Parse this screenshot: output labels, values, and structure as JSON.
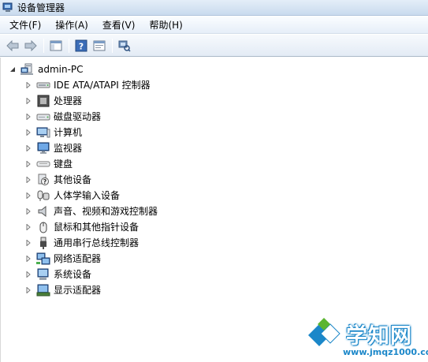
{
  "window": {
    "title": "设备管理器"
  },
  "menu": [
    {
      "label": "文件(F)"
    },
    {
      "label": "操作(A)"
    },
    {
      "label": "查看(V)"
    },
    {
      "label": "帮助(H)"
    }
  ],
  "toolbar": {
    "buttons": [
      {
        "icon": "back-arrow-icon"
      },
      {
        "icon": "forward-arrow-icon"
      },
      {
        "icon": "show-hide-console-tree-icon"
      },
      {
        "icon": "help-icon"
      },
      {
        "icon": "properties-icon"
      },
      {
        "icon": "scan-hardware-icon"
      }
    ]
  },
  "tree": {
    "root": {
      "label": "admin-PC",
      "icon": "computer-icon",
      "expanded": true
    },
    "items": [
      {
        "label": "IDE ATA/ATAPI 控制器",
        "icon": "ide-controller-icon"
      },
      {
        "label": "处理器",
        "icon": "processor-icon"
      },
      {
        "label": "磁盘驱动器",
        "icon": "disk-drive-icon"
      },
      {
        "label": "计算机",
        "icon": "computer-icon"
      },
      {
        "label": "监视器",
        "icon": "monitor-icon"
      },
      {
        "label": "键盘",
        "icon": "keyboard-icon"
      },
      {
        "label": "其他设备",
        "icon": "other-devices-icon"
      },
      {
        "label": "人体学输入设备",
        "icon": "hid-icon"
      },
      {
        "label": "声音、视频和游戏控制器",
        "icon": "speaker-icon"
      },
      {
        "label": "鼠标和其他指针设备",
        "icon": "mouse-icon"
      },
      {
        "label": "通用串行总线控制器",
        "icon": "usb-icon"
      },
      {
        "label": "网络适配器",
        "icon": "network-adapter-icon"
      },
      {
        "label": "系统设备",
        "icon": "system-devices-icon"
      },
      {
        "label": "显示适配器",
        "icon": "display-adapter-icon"
      }
    ]
  },
  "watermark": {
    "title": "学知网",
    "url": "www.jmqz1000.com",
    "colors": {
      "blue": "#1b87c9",
      "green": "#5cb531"
    }
  }
}
